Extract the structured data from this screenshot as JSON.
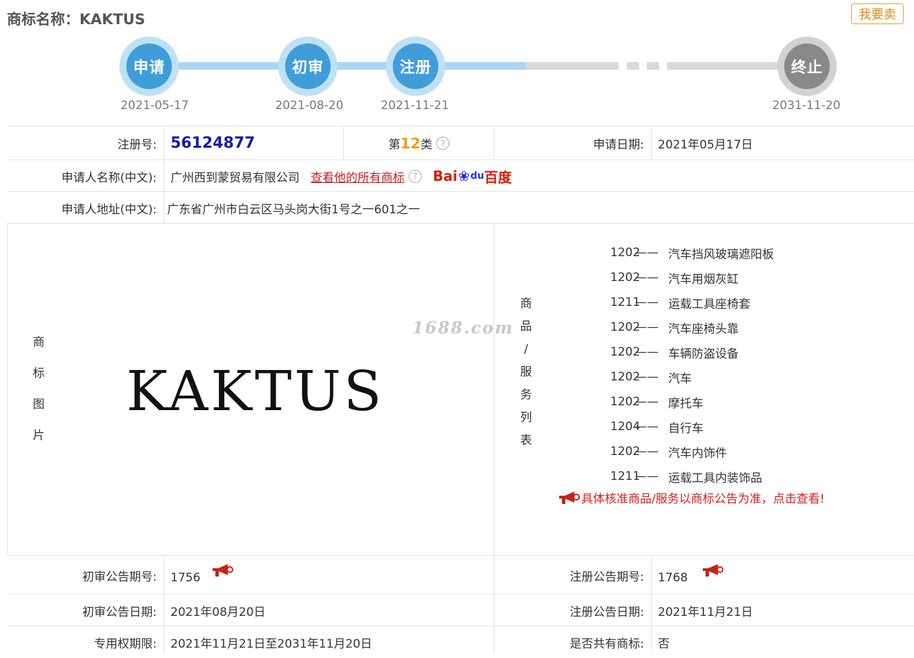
{
  "header": {
    "title": "商标名称：KAKTUS",
    "sell_button": "我要卖"
  },
  "timeline": {
    "steps": [
      {
        "label": "申请",
        "date": "2021-05-17",
        "state": "done"
      },
      {
        "label": "初审",
        "date": "2021-08-20",
        "state": "done"
      },
      {
        "label": "注册",
        "date": "2021-11-21",
        "state": "done"
      },
      {
        "label": "终止",
        "date": "2031-11-20",
        "state": "future"
      }
    ]
  },
  "info": {
    "reg_no_label": "注册号:",
    "reg_no": "56124877",
    "class_prefix": "第",
    "class_num": "12",
    "class_suffix": "类",
    "apply_date_label": "申请日期:",
    "apply_date": "2021年05月17日",
    "applicant_label": "申请人名称(中文):",
    "applicant": "广州西到蒙贸易有限公司",
    "all_marks_link": "查看他的所有商标",
    "baidu_left": "Bai",
    "baidu_mid": "du",
    "baidu_right": "百度",
    "address_label": "申请人地址(中文):",
    "address": "广东省广州市白云区马头岗大街1号之一601之一"
  },
  "image_section": {
    "label_chars": [
      "商",
      "标",
      "图",
      "片"
    ],
    "logo_text": "KAKTUS",
    "watermark": "1688.com"
  },
  "goods_section": {
    "label_chars": [
      "商",
      "品",
      "/",
      "服",
      "务",
      "列",
      "表"
    ],
    "items": [
      {
        "code": "1202",
        "dash": "——",
        "name": "汽车挡风玻璃遮阳板"
      },
      {
        "code": "1202",
        "dash": "——",
        "name": "汽车用烟灰缸"
      },
      {
        "code": "1211",
        "dash": "——",
        "name": "运载工具座椅套"
      },
      {
        "code": "1202",
        "dash": "——",
        "name": "汽车座椅头靠"
      },
      {
        "code": "1202",
        "dash": "——",
        "name": "车辆防盗设备"
      },
      {
        "code": "1202",
        "dash": "——",
        "name": "汽车"
      },
      {
        "code": "1202",
        "dash": "——",
        "name": "摩托车"
      },
      {
        "code": "1204",
        "dash": "——",
        "name": "自行车"
      },
      {
        "code": "1202",
        "dash": "——",
        "name": "汽车内饰件"
      },
      {
        "code": "1211",
        "dash": "——",
        "name": "运载工具内装饰品"
      }
    ],
    "notice": "具体核准商品/服务以商标公告为准，点击查看!"
  },
  "bottom": {
    "prelim_no_label": "初审公告期号:",
    "prelim_no": "1756",
    "reg_pub_no_label": "注册公告期号:",
    "reg_pub_no": "1768",
    "prelim_date_label": "初审公告日期:",
    "prelim_date": "2021年08月20日",
    "reg_pub_date_label": "注册公告日期:",
    "reg_pub_date": "2021年11月21日",
    "term_label": "专用权期限:",
    "term": "2021年11月21日至2031年11月20日",
    "shared_label": "是否共有商标:",
    "shared": "否"
  },
  "colors": {
    "accent_blue": "#3f9ed9",
    "grey": "#8a8888",
    "link_red": "#b22222",
    "orange": "#f39b1a"
  }
}
